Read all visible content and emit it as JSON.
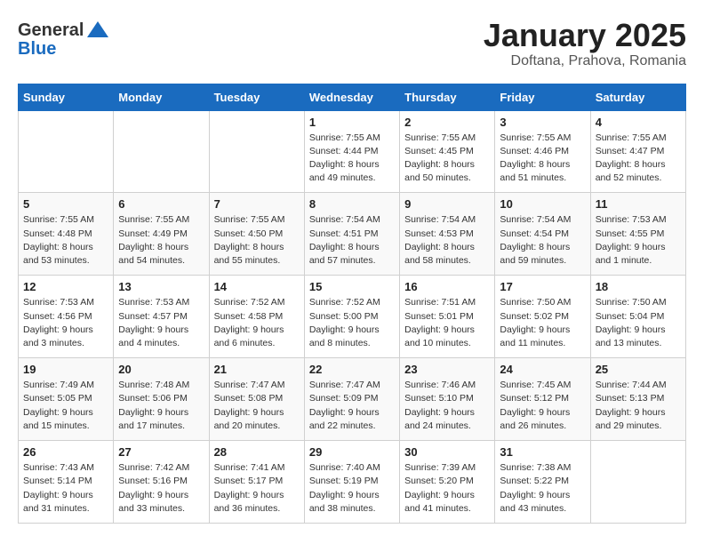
{
  "logo": {
    "general": "General",
    "blue": "Blue"
  },
  "title": "January 2025",
  "location": "Doftana, Prahova, Romania",
  "weekdays": [
    "Sunday",
    "Monday",
    "Tuesday",
    "Wednesday",
    "Thursday",
    "Friday",
    "Saturday"
  ],
  "weeks": [
    [
      {
        "day": "",
        "text": ""
      },
      {
        "day": "",
        "text": ""
      },
      {
        "day": "",
        "text": ""
      },
      {
        "day": "1",
        "text": "Sunrise: 7:55 AM\nSunset: 4:44 PM\nDaylight: 8 hours\nand 49 minutes."
      },
      {
        "day": "2",
        "text": "Sunrise: 7:55 AM\nSunset: 4:45 PM\nDaylight: 8 hours\nand 50 minutes."
      },
      {
        "day": "3",
        "text": "Sunrise: 7:55 AM\nSunset: 4:46 PM\nDaylight: 8 hours\nand 51 minutes."
      },
      {
        "day": "4",
        "text": "Sunrise: 7:55 AM\nSunset: 4:47 PM\nDaylight: 8 hours\nand 52 minutes."
      }
    ],
    [
      {
        "day": "5",
        "text": "Sunrise: 7:55 AM\nSunset: 4:48 PM\nDaylight: 8 hours\nand 53 minutes."
      },
      {
        "day": "6",
        "text": "Sunrise: 7:55 AM\nSunset: 4:49 PM\nDaylight: 8 hours\nand 54 minutes."
      },
      {
        "day": "7",
        "text": "Sunrise: 7:55 AM\nSunset: 4:50 PM\nDaylight: 8 hours\nand 55 minutes."
      },
      {
        "day": "8",
        "text": "Sunrise: 7:54 AM\nSunset: 4:51 PM\nDaylight: 8 hours\nand 57 minutes."
      },
      {
        "day": "9",
        "text": "Sunrise: 7:54 AM\nSunset: 4:53 PM\nDaylight: 8 hours\nand 58 minutes."
      },
      {
        "day": "10",
        "text": "Sunrise: 7:54 AM\nSunset: 4:54 PM\nDaylight: 8 hours\nand 59 minutes."
      },
      {
        "day": "11",
        "text": "Sunrise: 7:53 AM\nSunset: 4:55 PM\nDaylight: 9 hours\nand 1 minute."
      }
    ],
    [
      {
        "day": "12",
        "text": "Sunrise: 7:53 AM\nSunset: 4:56 PM\nDaylight: 9 hours\nand 3 minutes."
      },
      {
        "day": "13",
        "text": "Sunrise: 7:53 AM\nSunset: 4:57 PM\nDaylight: 9 hours\nand 4 minutes."
      },
      {
        "day": "14",
        "text": "Sunrise: 7:52 AM\nSunset: 4:58 PM\nDaylight: 9 hours\nand 6 minutes."
      },
      {
        "day": "15",
        "text": "Sunrise: 7:52 AM\nSunset: 5:00 PM\nDaylight: 9 hours\nand 8 minutes."
      },
      {
        "day": "16",
        "text": "Sunrise: 7:51 AM\nSunset: 5:01 PM\nDaylight: 9 hours\nand 10 minutes."
      },
      {
        "day": "17",
        "text": "Sunrise: 7:50 AM\nSunset: 5:02 PM\nDaylight: 9 hours\nand 11 minutes."
      },
      {
        "day": "18",
        "text": "Sunrise: 7:50 AM\nSunset: 5:04 PM\nDaylight: 9 hours\nand 13 minutes."
      }
    ],
    [
      {
        "day": "19",
        "text": "Sunrise: 7:49 AM\nSunset: 5:05 PM\nDaylight: 9 hours\nand 15 minutes."
      },
      {
        "day": "20",
        "text": "Sunrise: 7:48 AM\nSunset: 5:06 PM\nDaylight: 9 hours\nand 17 minutes."
      },
      {
        "day": "21",
        "text": "Sunrise: 7:47 AM\nSunset: 5:08 PM\nDaylight: 9 hours\nand 20 minutes."
      },
      {
        "day": "22",
        "text": "Sunrise: 7:47 AM\nSunset: 5:09 PM\nDaylight: 9 hours\nand 22 minutes."
      },
      {
        "day": "23",
        "text": "Sunrise: 7:46 AM\nSunset: 5:10 PM\nDaylight: 9 hours\nand 24 minutes."
      },
      {
        "day": "24",
        "text": "Sunrise: 7:45 AM\nSunset: 5:12 PM\nDaylight: 9 hours\nand 26 minutes."
      },
      {
        "day": "25",
        "text": "Sunrise: 7:44 AM\nSunset: 5:13 PM\nDaylight: 9 hours\nand 29 minutes."
      }
    ],
    [
      {
        "day": "26",
        "text": "Sunrise: 7:43 AM\nSunset: 5:14 PM\nDaylight: 9 hours\nand 31 minutes."
      },
      {
        "day": "27",
        "text": "Sunrise: 7:42 AM\nSunset: 5:16 PM\nDaylight: 9 hours\nand 33 minutes."
      },
      {
        "day": "28",
        "text": "Sunrise: 7:41 AM\nSunset: 5:17 PM\nDaylight: 9 hours\nand 36 minutes."
      },
      {
        "day": "29",
        "text": "Sunrise: 7:40 AM\nSunset: 5:19 PM\nDaylight: 9 hours\nand 38 minutes."
      },
      {
        "day": "30",
        "text": "Sunrise: 7:39 AM\nSunset: 5:20 PM\nDaylight: 9 hours\nand 41 minutes."
      },
      {
        "day": "31",
        "text": "Sunrise: 7:38 AM\nSunset: 5:22 PM\nDaylight: 9 hours\nand 43 minutes."
      },
      {
        "day": "",
        "text": ""
      }
    ]
  ]
}
